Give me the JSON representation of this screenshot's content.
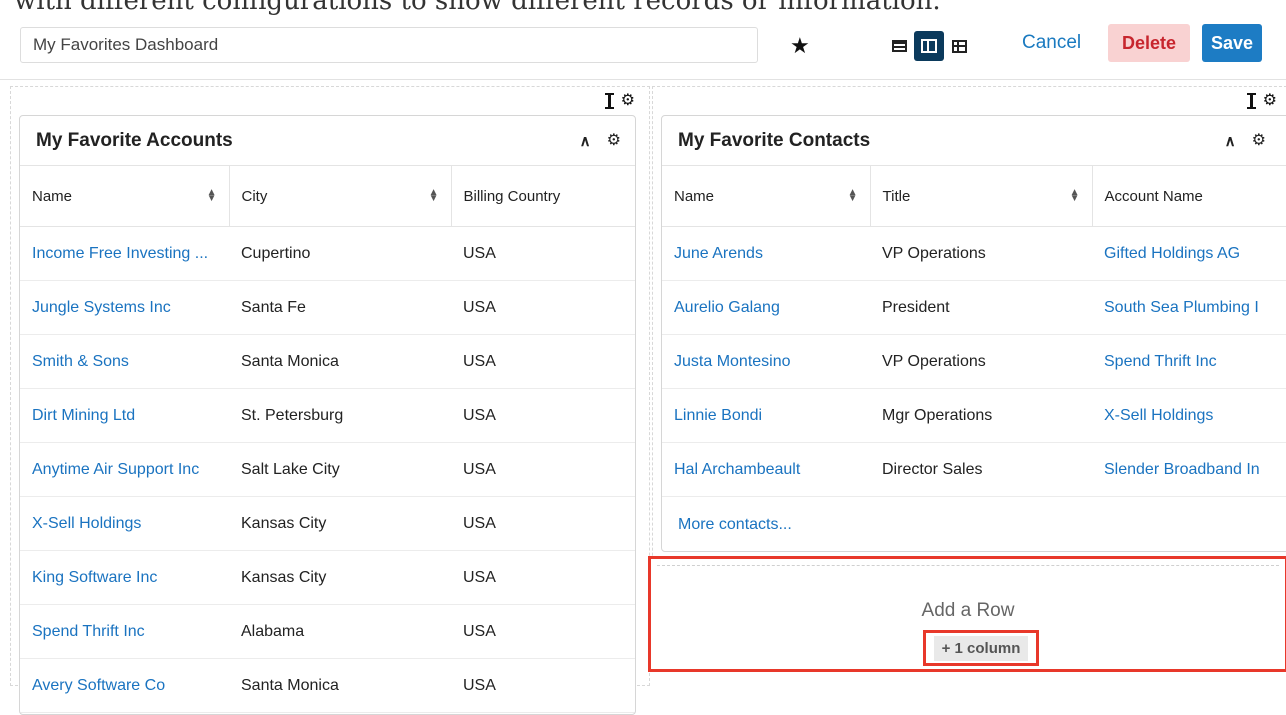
{
  "caption": "with different configurations to show different records or information.",
  "toolbar": {
    "dashboard_name": "My Favorites Dashboard",
    "cancel_label": "Cancel",
    "delete_label": "Delete",
    "save_label": "Save"
  },
  "accounts": {
    "title": "My Favorite Accounts",
    "columns": [
      "Name",
      "City",
      "Billing Country"
    ],
    "rows": [
      [
        "Income Free Investing ...",
        "Cupertino",
        "USA"
      ],
      [
        "Jungle Systems Inc",
        "Santa Fe",
        "USA"
      ],
      [
        "Smith & Sons",
        "Santa Monica",
        "USA"
      ],
      [
        "Dirt Mining Ltd",
        "St. Petersburg",
        "USA"
      ],
      [
        "Anytime Air Support Inc",
        "Salt Lake City",
        "USA"
      ],
      [
        "X-Sell Holdings",
        "Kansas City",
        "USA"
      ],
      [
        "King Software Inc",
        "Kansas City",
        "USA"
      ],
      [
        "Spend Thrift Inc",
        "Alabama",
        "USA"
      ],
      [
        "Avery Software Co",
        "Santa Monica",
        "USA"
      ]
    ]
  },
  "contacts": {
    "title": "My Favorite Contacts",
    "columns": [
      "Name",
      "Title",
      "Account Name"
    ],
    "rows": [
      [
        "June Arends",
        "VP Operations",
        "Gifted Holdings AG"
      ],
      [
        "Aurelio Galang",
        "President",
        "South Sea Plumbing I"
      ],
      [
        "Justa Montesino",
        "VP Operations",
        "Spend Thrift Inc"
      ],
      [
        "Linnie Bondi",
        "Mgr Operations",
        "X-Sell Holdings"
      ],
      [
        "Hal Archambeault",
        "Director Sales",
        "Slender Broadband In"
      ]
    ],
    "more_label": "More contacts..."
  },
  "add_row": {
    "label": "Add a Row",
    "add_column_label": "+ 1 column"
  },
  "colors": {
    "link": "#1a73c0",
    "save": "#1d7cc4",
    "delete_bg": "#f9d2d2",
    "highlight": "#e8382a"
  }
}
